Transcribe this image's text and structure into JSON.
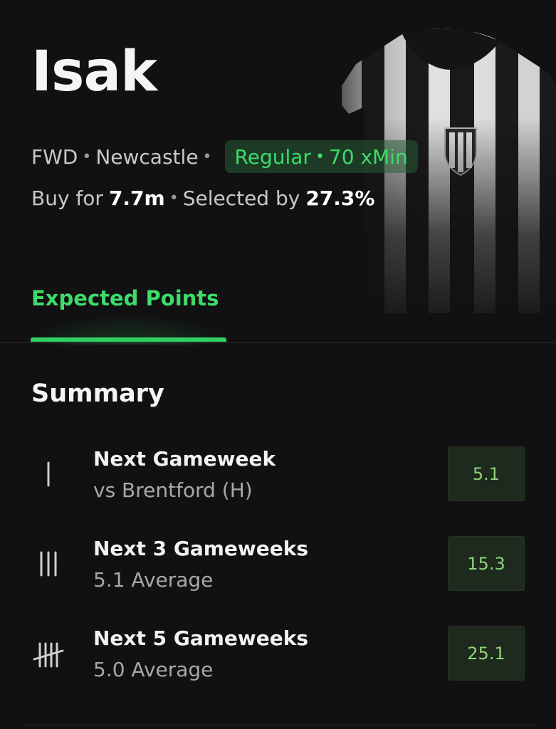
{
  "player": {
    "name": "Isak",
    "position": "FWD",
    "team": "Newcastle",
    "status_label": "Regular",
    "expected_minutes": "70 xMin",
    "buy_prefix": "Buy for",
    "price": "7.7m",
    "selected_prefix": "Selected by",
    "selected_pct": "27.3%"
  },
  "tabs": [
    {
      "label": "Expected Points",
      "active": true
    }
  ],
  "summary": {
    "title": "Summary",
    "rows": [
      {
        "icon": "tally-1-icon",
        "title": "Next Gameweek",
        "subtitle": "vs Brentford (H)",
        "value": "5.1"
      },
      {
        "icon": "tally-3-icon",
        "title": "Next 3 Gameweeks",
        "subtitle": "5.1 Average",
        "value": "15.3"
      },
      {
        "icon": "tally-5-icon",
        "title": "Next 5 Gameweeks",
        "subtitle": "5.0 Average",
        "value": "25.1"
      }
    ]
  },
  "colors": {
    "background": "#111012",
    "accent_green": "#3ddc6a",
    "value_green": "#8fd17a"
  }
}
